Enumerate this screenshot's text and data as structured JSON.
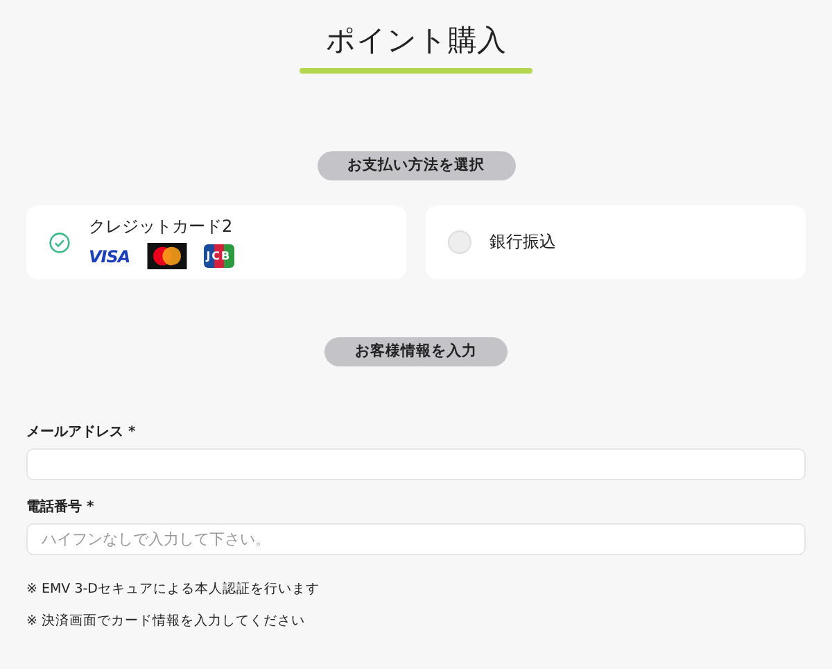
{
  "title": "ポイント購入",
  "payment_section": {
    "heading": "お支払い方法を選択",
    "methods": [
      {
        "label": "クレジットカード2",
        "selected": true,
        "brands": [
          {
            "kind": "visa",
            "text": "VISA"
          },
          {
            "kind": "mastercard"
          },
          {
            "kind": "jcb",
            "text": "JCB"
          }
        ]
      },
      {
        "label": "銀行振込",
        "selected": false
      }
    ]
  },
  "customer_section": {
    "heading": "お客様情報を入力",
    "fields": [
      {
        "label": "メールアドレス *"
      },
      {
        "label": "電話番号 *",
        "placeholder": "ハイフンなしで入力して下さい。"
      }
    ]
  },
  "notes": [
    "※ EMV 3-Dセキュアによる本人認証を行います",
    "※ 決済画面でカード情報を入力してください"
  ]
}
